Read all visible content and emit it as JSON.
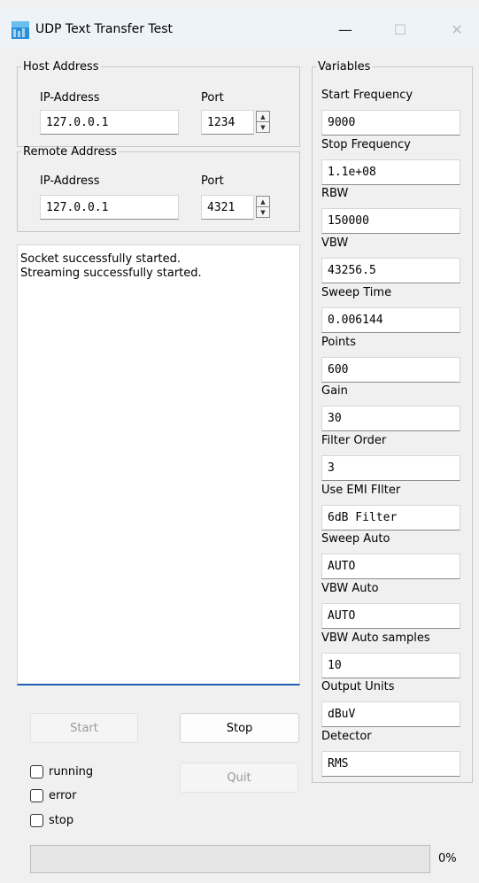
{
  "window": {
    "title": "UDP Text Transfer Test",
    "minimize_icon": "—",
    "maximize_icon": "☐",
    "close_icon": "✕"
  },
  "host": {
    "legend": "Host Address",
    "ip_label": "IP-Address",
    "port_label": "Port",
    "ip_value": "127.0.0.1",
    "port_value": "1234"
  },
  "remote": {
    "legend": "Remote Address",
    "ip_label": "IP-Address",
    "port_label": "Port",
    "ip_value": "127.0.0.1",
    "port_value": "4321"
  },
  "log": {
    "text": "Socket successfully started.\nStreaming successfully started."
  },
  "variables": {
    "legend": "Variables",
    "items": [
      {
        "label": "Start Frequency",
        "value": "9000"
      },
      {
        "label": "Stop Frequency",
        "value": "1.1e+08"
      },
      {
        "label": "RBW",
        "value": "150000"
      },
      {
        "label": "VBW",
        "value": "43256.5"
      },
      {
        "label": "Sweep Time",
        "value": "0.006144"
      },
      {
        "label": "Points",
        "value": "600"
      },
      {
        "label": "Gain",
        "value": "30"
      },
      {
        "label": "Filter Order",
        "value": "3"
      },
      {
        "label": "Use EMI FIlter",
        "value": "6dB Filter"
      },
      {
        "label": "Sweep Auto",
        "value": "AUTO"
      },
      {
        "label": "VBW Auto",
        "value": "AUTO"
      },
      {
        "label": "VBW Auto samples",
        "value": "10"
      },
      {
        "label": "Output Units",
        "value": "dBuV"
      },
      {
        "label": "Detector",
        "value": "RMS"
      }
    ]
  },
  "buttons": {
    "start": "Start",
    "stop": "Stop",
    "quit": "Quit"
  },
  "checkboxes": [
    {
      "label": "running",
      "checked": false
    },
    {
      "label": "error",
      "checked": false
    },
    {
      "label": "stop",
      "checked": false
    }
  ],
  "progress": {
    "value": 0,
    "text": "0%"
  }
}
